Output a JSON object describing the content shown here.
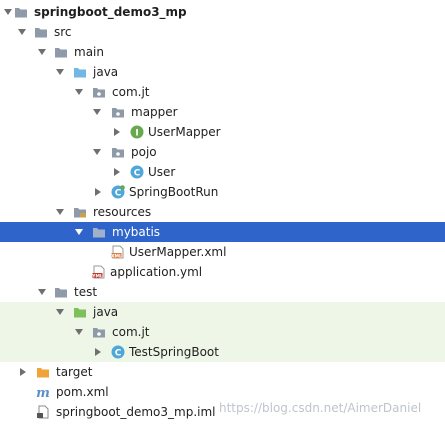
{
  "tree": {
    "project": "springboot_demo3_mp",
    "src": "src",
    "main": "main",
    "main_java": "java",
    "com_jt": "com.jt",
    "mapper": "mapper",
    "user_mapper": "UserMapper",
    "pojo": "pojo",
    "user": "User",
    "springbootrun": "SpringBootRun",
    "resources": "resources",
    "mybatis": "mybatis",
    "user_mapper_xml": "UserMapper.xml",
    "application_yml": "application.yml",
    "test": "test",
    "test_java": "java",
    "test_com_jt": "com.jt",
    "test_springboot": "TestSpringBoot",
    "target": "target",
    "pom": "pom.xml",
    "iml": "springboot_demo3_mp.iml"
  },
  "watermark": "https://blog.csdn.net/AimerDaniel",
  "icons": {
    "folder": "folder-icon",
    "source_folder": "source-folder-icon",
    "test_folder": "test-folder-icon",
    "resources_folder": "resources-folder-icon",
    "package": "package-icon",
    "interface": "interface-icon",
    "class": "class-icon",
    "spring_class": "spring-class-icon",
    "xml_file": "xml-file-icon",
    "yml_file": "yml-file-icon",
    "maven": "maven-icon",
    "iml_file": "iml-file-icon",
    "excluded_folder": "excluded-folder-icon"
  },
  "colors": {
    "selection": "#2f65ca",
    "test_background": "#eef6e8",
    "folder": "#8f9aa8",
    "source_folder": "#73b7e4",
    "test_folder": "#7fbf5a",
    "target_folder": "#f0a33a",
    "interface": "#6aa84f",
    "class": "#4fa6d8",
    "watermark": "#bfc4cc"
  }
}
